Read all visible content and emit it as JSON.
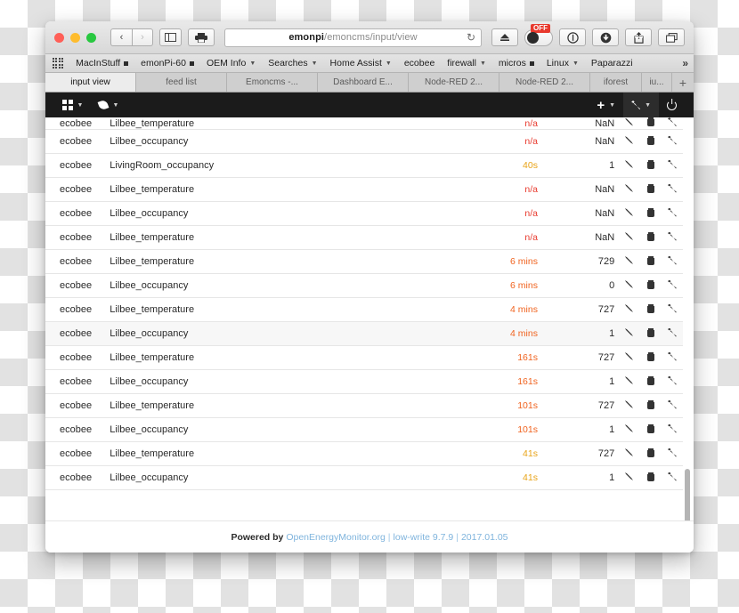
{
  "browser": {
    "traffic_lights": [
      "close",
      "minimize",
      "maximize"
    ],
    "nav_back": "‹",
    "nav_forward": "›",
    "sidebar_icon": "sidebar-icon",
    "print_icon": "print-icon",
    "url": {
      "host": "emonpi",
      "path": "/emoncms/input/view"
    },
    "reload_label": "↻",
    "share_icon": "share-icon",
    "download_icon": "download-icon",
    "info_icon": "info-icon",
    "eject_icon": "eject-icon",
    "toggle_badge": "OFF",
    "tabs_overview_icon": "tabs-overview-icon"
  },
  "bookmarks": {
    "apps_icon": "apps-grid-icon",
    "items": [
      {
        "label": "MacInStuff",
        "marker": "square"
      },
      {
        "label": "emonPi-60",
        "marker": "square"
      },
      {
        "label": "OEM Info",
        "marker": "caret"
      },
      {
        "label": "Searches",
        "marker": "caret"
      },
      {
        "label": "Home Assist",
        "marker": "caret"
      },
      {
        "label": "ecobee",
        "marker": "none"
      },
      {
        "label": "firewall",
        "marker": "caret"
      },
      {
        "label": "micros",
        "marker": "square"
      },
      {
        "label": "Linux",
        "marker": "caret"
      },
      {
        "label": "Paparazzi",
        "marker": "none"
      }
    ],
    "overflow": "»"
  },
  "browser_tabs": {
    "items": [
      {
        "label": "input view",
        "active": true
      },
      {
        "label": "feed list",
        "active": false
      },
      {
        "label": "Emoncms -...",
        "active": false
      },
      {
        "label": "Dashboard E...",
        "active": false
      },
      {
        "label": "Node-RED 2...",
        "active": false
      },
      {
        "label": "Node-RED 2...",
        "active": false
      },
      {
        "label": "iforest",
        "active": false
      },
      {
        "label": "iu...",
        "active": false
      }
    ],
    "new_tab_label": "+"
  },
  "appnav": {
    "left": [
      {
        "name": "dashboard-grid",
        "icon": "grid-icon",
        "caret": "▾"
      },
      {
        "name": "feeds-leaf",
        "icon": "leaf-icon",
        "caret": "▾"
      }
    ],
    "right": [
      {
        "name": "add",
        "icon": "plus-icon",
        "caret": "▾"
      },
      {
        "name": "tools",
        "icon": "wrench-icon",
        "caret": "▾"
      },
      {
        "name": "power",
        "icon": "power-icon",
        "caret": ""
      }
    ]
  },
  "table": {
    "rows": [
      {
        "node": "ecobee",
        "name": "Lilbee_temperature",
        "time": "n/a",
        "time_color": "red",
        "value": "NaN",
        "alt": false,
        "clipped": true
      },
      {
        "node": "ecobee",
        "name": "Lilbee_occupancy",
        "time": "n/a",
        "time_color": "red",
        "value": "NaN",
        "alt": false
      },
      {
        "node": "ecobee",
        "name": "LivingRoom_occupancy",
        "time": "40s",
        "time_color": "amber",
        "value": "1",
        "alt": false
      },
      {
        "node": "ecobee",
        "name": "Lilbee_temperature",
        "time": "n/a",
        "time_color": "red",
        "value": "NaN",
        "alt": false
      },
      {
        "node": "ecobee",
        "name": "Lilbee_occupancy",
        "time": "n/a",
        "time_color": "red",
        "value": "NaN",
        "alt": false
      },
      {
        "node": "ecobee",
        "name": "Lilbee_temperature",
        "time": "n/a",
        "time_color": "red",
        "value": "NaN",
        "alt": false
      },
      {
        "node": "ecobee",
        "name": "Lilbee_temperature",
        "time": "6 mins",
        "time_color": "orange",
        "value": "729",
        "alt": false
      },
      {
        "node": "ecobee",
        "name": "Lilbee_occupancy",
        "time": "6 mins",
        "time_color": "orange",
        "value": "0",
        "alt": false
      },
      {
        "node": "ecobee",
        "name": "Lilbee_temperature",
        "time": "4 mins",
        "time_color": "orange",
        "value": "727",
        "alt": false
      },
      {
        "node": "ecobee",
        "name": "Lilbee_occupancy",
        "time": "4 mins",
        "time_color": "orange",
        "value": "1",
        "alt": true
      },
      {
        "node": "ecobee",
        "name": "Lilbee_temperature",
        "time": "161s",
        "time_color": "orange",
        "value": "727",
        "alt": false
      },
      {
        "node": "ecobee",
        "name": "Lilbee_occupancy",
        "time": "161s",
        "time_color": "orange",
        "value": "1",
        "alt": false
      },
      {
        "node": "ecobee",
        "name": "Lilbee_temperature",
        "time": "101s",
        "time_color": "orange",
        "value": "727",
        "alt": false
      },
      {
        "node": "ecobee",
        "name": "Lilbee_occupancy",
        "time": "101s",
        "time_color": "orange",
        "value": "1",
        "alt": false
      },
      {
        "node": "ecobee",
        "name": "Lilbee_temperature",
        "time": "41s",
        "time_color": "amber",
        "value": "727",
        "alt": false
      },
      {
        "node": "ecobee",
        "name": "Lilbee_occupancy",
        "time": "41s",
        "time_color": "amber",
        "value": "1",
        "alt": false
      }
    ],
    "actions": {
      "edit": "pencil-icon",
      "delete": "trash-icon",
      "configure": "wrench-icon"
    }
  },
  "footer": {
    "powered_by": "Powered by",
    "link": "OpenEnergyMonitor.org",
    "sep1": "|",
    "version": "low-write 9.7.9",
    "sep2": "|",
    "date": "2017.01.05"
  },
  "colors": {
    "red": "#e8392d",
    "orange": "#f0631f",
    "amber": "#e8a317",
    "link": "#7fb4dd",
    "nav_bg": "#1b1b1b"
  }
}
